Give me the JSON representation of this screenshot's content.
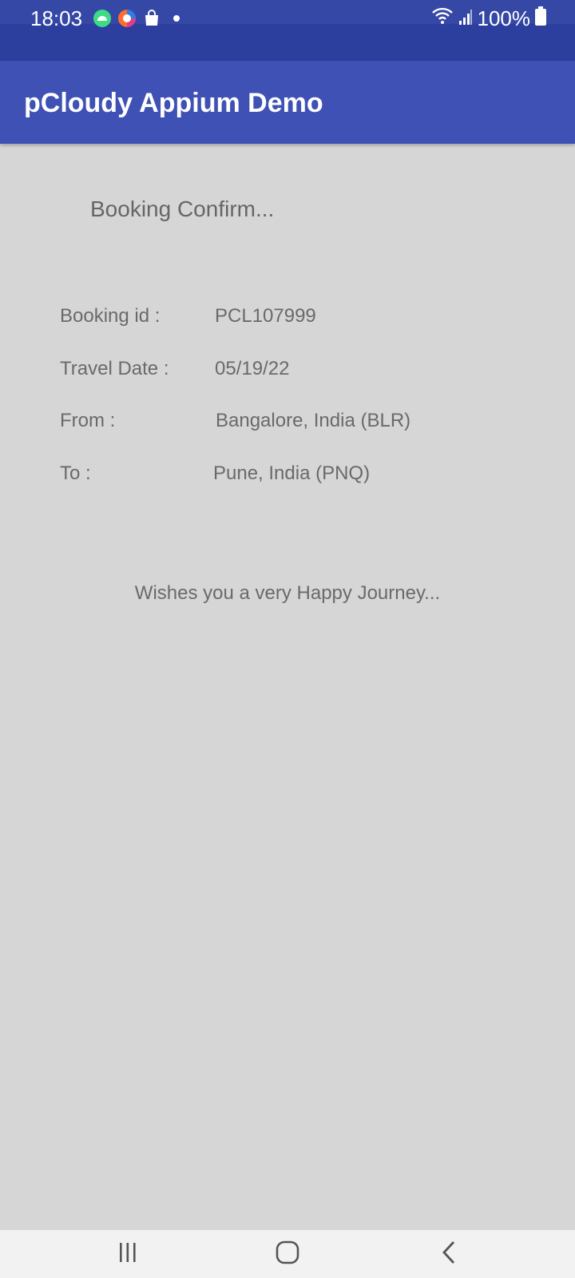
{
  "status_bar": {
    "time": "18:03",
    "battery_text": "100%",
    "icons_left": [
      "android-notification-icon",
      "browser-icon",
      "shopping-bag-icon",
      "dot-icon"
    ],
    "icons_right": [
      "wifi-icon",
      "signal-icon",
      "battery-icon"
    ]
  },
  "app_bar": {
    "title": "pCloudy Appium Demo",
    "color": "#3f51b5"
  },
  "content": {
    "heading": "Booking Confirm...",
    "details": [
      {
        "label": "Booking id :",
        "value": "PCL107999"
      },
      {
        "label": "Travel Date :",
        "value": "05/19/22"
      },
      {
        "label": "From :",
        "value": "Bangalore, India (BLR)"
      },
      {
        "label": "To :",
        "value": "Pune, India (PNQ)"
      }
    ],
    "wish": "Wishes you a very Happy Journey..."
  },
  "nav_bar": {
    "buttons": [
      "recent-apps-icon",
      "home-icon",
      "back-icon"
    ]
  }
}
